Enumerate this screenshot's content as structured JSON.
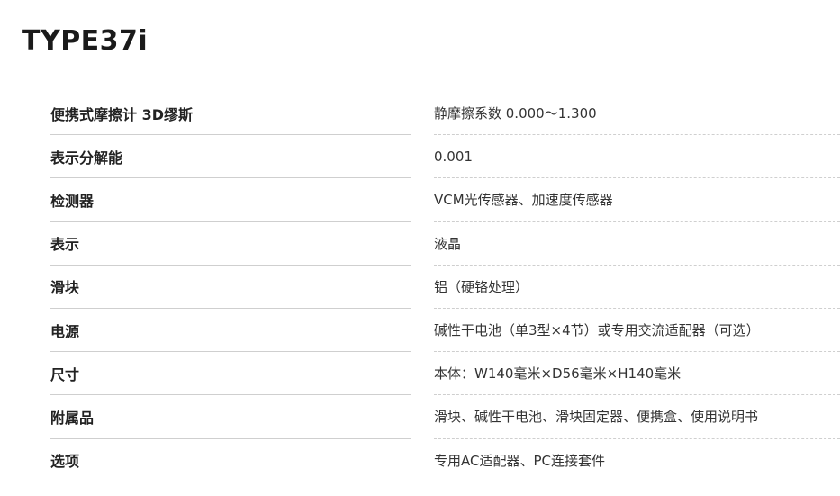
{
  "title": "TYPE37i",
  "rows": [
    {
      "label": "便携式摩擦计 3D缪斯",
      "value": "静摩擦系数 0.000～1.300"
    },
    {
      "label": "表示分解能",
      "value": "0.001"
    },
    {
      "label": "检测器",
      "value": "VCM光传感器、加速度传感器"
    },
    {
      "label": "表示",
      "value": "液晶"
    },
    {
      "label": "滑块",
      "value": "铝（硬铬处理）"
    },
    {
      "label": "电源",
      "value": "碱性干电池（单3型×4节）或专用交流适配器（可选）"
    },
    {
      "label": "尺寸",
      "value": "本体：W140毫米×D56毫米×H140毫米"
    },
    {
      "label": "附属品",
      "value": "滑块、碱性干电池、滑块固定器、便携盒、使用说明书"
    },
    {
      "label": "选项",
      "value": "专用AC适配器、PC连接套件"
    }
  ]
}
